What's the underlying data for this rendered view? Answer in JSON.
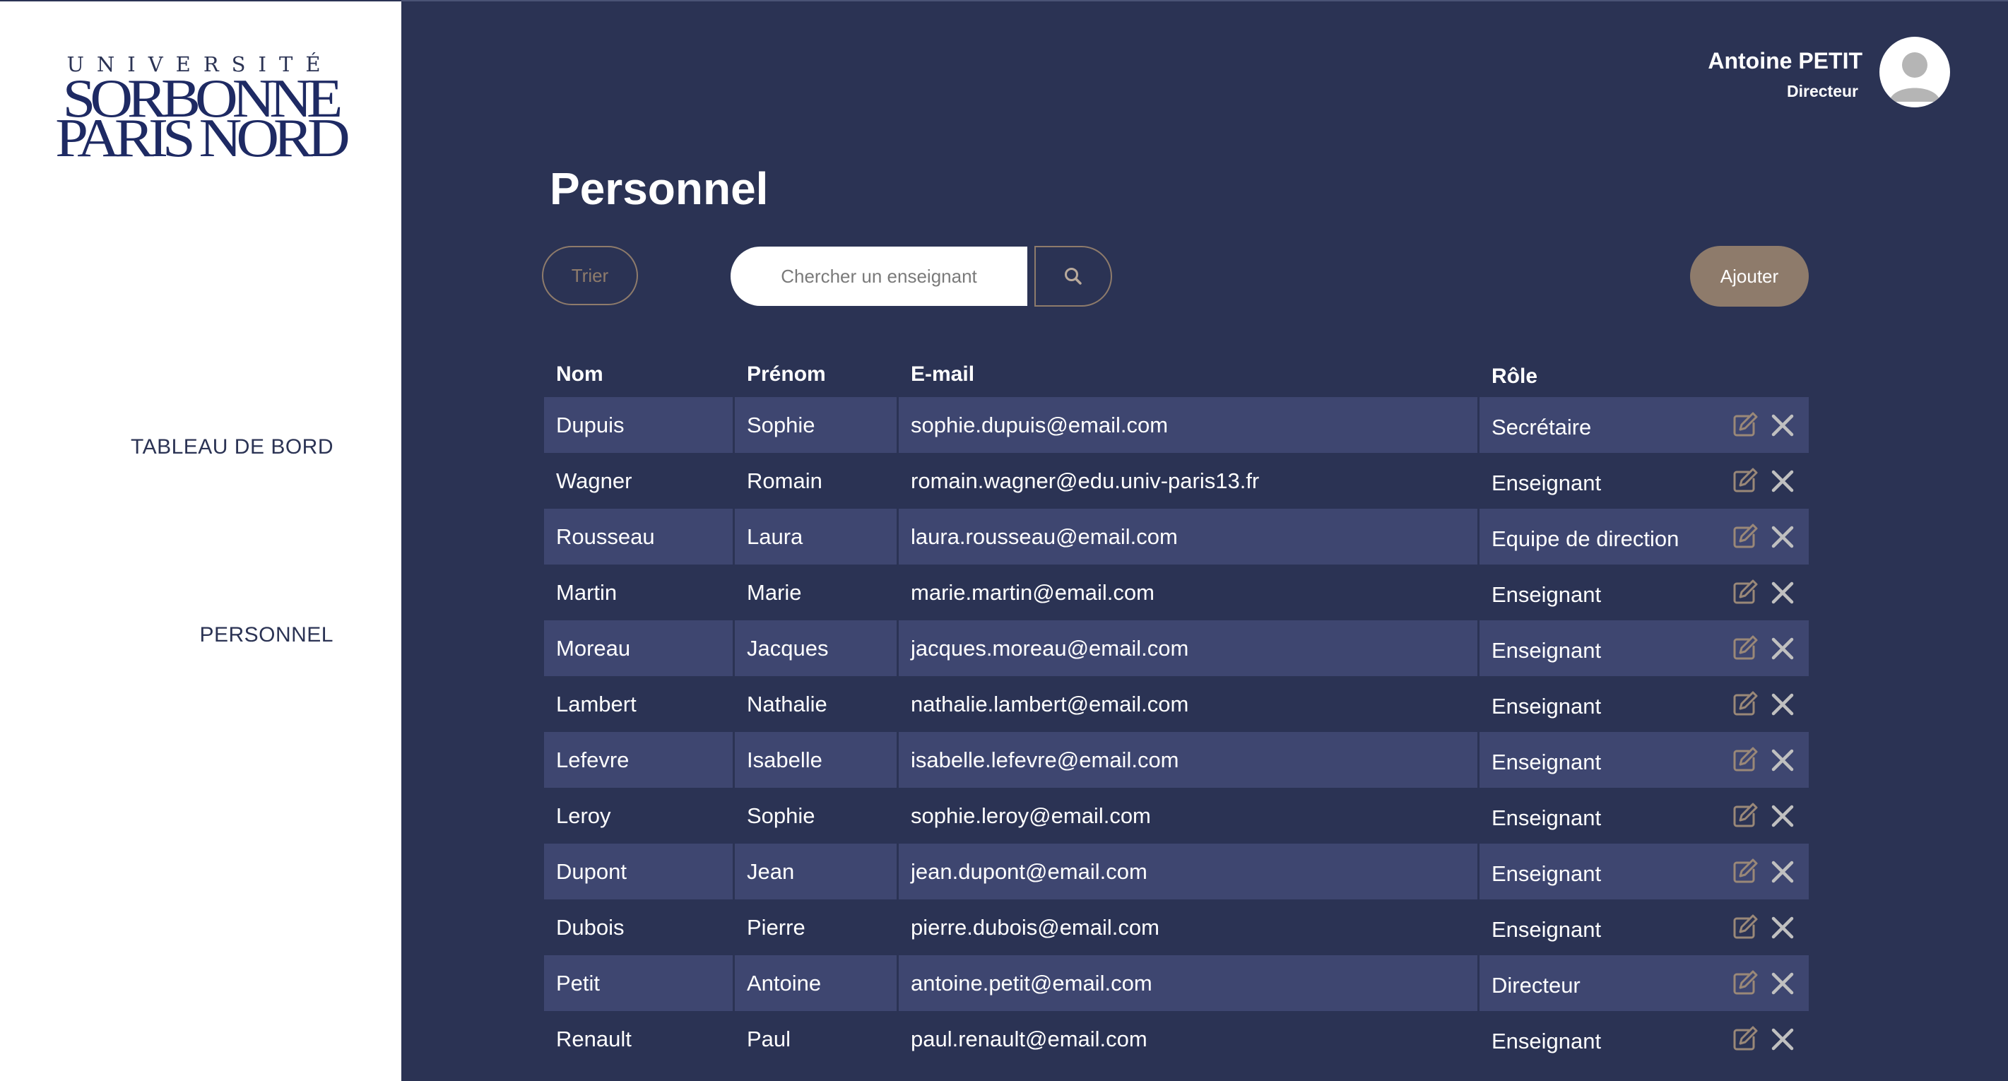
{
  "sidebar": {
    "logo": {
      "line1": "UNIVERSITÉ",
      "line2": "SORBONNE",
      "line3": "PARIS NORD"
    },
    "nav": [
      "TABLEAU DE BORD",
      "PERSONNEL"
    ]
  },
  "header": {
    "user_name": "Antoine PETIT",
    "user_role": "Directeur",
    "avatar_icon": "user-avatar-icon"
  },
  "main": {
    "title": "Personnel",
    "sort_label": "Trier",
    "search_placeholder": "Chercher un enseignant",
    "search_icon": "search-icon",
    "add_label": "Ajouter"
  },
  "table": {
    "columns": [
      "Nom",
      "Prénom",
      "E-mail",
      "Rôle"
    ],
    "action_icons": [
      "edit-icon",
      "close-icon"
    ],
    "rows": [
      {
        "nom": "Dupuis",
        "prenom": "Sophie",
        "email": "sophie.dupuis@email.com",
        "role": "Secrétaire"
      },
      {
        "nom": "Wagner",
        "prenom": "Romain",
        "email": "romain.wagner@edu.univ-paris13.fr",
        "role": "Enseignant"
      },
      {
        "nom": "Rousseau",
        "prenom": "Laura",
        "email": "laura.rousseau@email.com",
        "role": "Equipe de direction"
      },
      {
        "nom": "Martin",
        "prenom": "Marie",
        "email": "marie.martin@email.com",
        "role": "Enseignant"
      },
      {
        "nom": "Moreau",
        "prenom": "Jacques",
        "email": "jacques.moreau@email.com",
        "role": "Enseignant"
      },
      {
        "nom": "Lambert",
        "prenom": "Nathalie",
        "email": "nathalie.lambert@email.com",
        "role": "Enseignant"
      },
      {
        "nom": "Lefevre",
        "prenom": "Isabelle",
        "email": "isabelle.lefevre@email.com",
        "role": "Enseignant"
      },
      {
        "nom": "Leroy",
        "prenom": "Sophie",
        "email": "sophie.leroy@email.com",
        "role": "Enseignant"
      },
      {
        "nom": "Dupont",
        "prenom": "Jean",
        "email": "jean.dupont@email.com",
        "role": "Enseignant"
      },
      {
        "nom": "Dubois",
        "prenom": "Pierre",
        "email": "pierre.dubois@email.com",
        "role": "Enseignant"
      },
      {
        "nom": "Petit",
        "prenom": "Antoine",
        "email": "antoine.petit@email.com",
        "role": "Directeur"
      },
      {
        "nom": "Renault",
        "prenom": "Paul",
        "email": "paul.renault@email.com",
        "role": "Enseignant"
      }
    ]
  },
  "colors": {
    "sidebar_bg": "#ffffff",
    "main_bg": "#2b3354",
    "row_alt_bg": "#3e4670",
    "accent": "#8e7b6b",
    "logo_text": "#1e2a63",
    "text": "#ffffff"
  }
}
